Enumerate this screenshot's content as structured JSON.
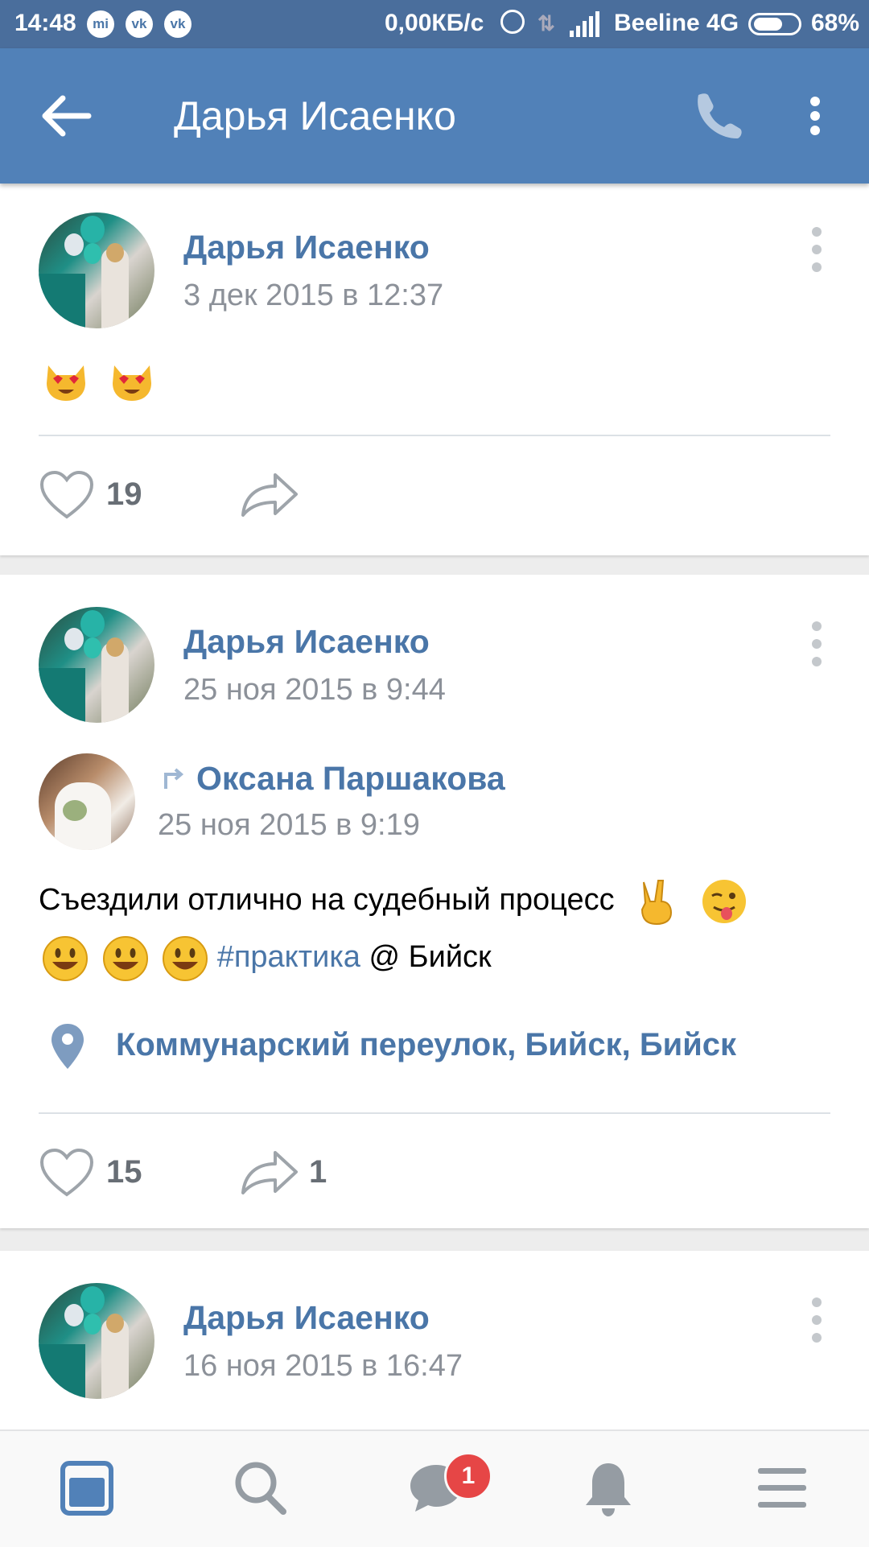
{
  "status_bar": {
    "time": "14:48",
    "notif_icons": [
      "mi-icon",
      "vk-icon",
      "vk-icon"
    ],
    "net_speed": "0,00КБ/с",
    "carrier": "Beeline 4G",
    "battery": "68%",
    "battery_level": 0.68
  },
  "app_bar": {
    "title": "Дарья Исаенко"
  },
  "posts": [
    {
      "author": "Дарья Исаенко",
      "date": "3 дек 2015 в 12:37",
      "text_emoji": [
        "heart-eyes-cat",
        "heart-eyes-cat"
      ],
      "likes": "19",
      "shares": ""
    },
    {
      "author": "Дарья Исаенко",
      "date": "25 ноя 2015 в 9:44",
      "repost": {
        "author": "Оксана Паршакова",
        "date": "25 ноя 2015 в 9:19",
        "text_line1": "Съездили отлично на судебный процесс",
        "hashtag": "#практика",
        "text_tail": "@ Бийск",
        "location": "Коммунарский переулок, Бийск, Бийск"
      },
      "likes": "15",
      "shares": "1"
    },
    {
      "author": "Дарья Исаенко",
      "date": "16 ноя 2015 в 16:47"
    }
  ],
  "bottom_nav": {
    "items": [
      "news",
      "search",
      "messages",
      "notifications",
      "menu"
    ],
    "messages_badge": "1"
  },
  "colors": {
    "app_bar": "#5181b8",
    "status_bar": "#4a6e9c",
    "link": "#4a76a8",
    "badge": "#e64646"
  }
}
